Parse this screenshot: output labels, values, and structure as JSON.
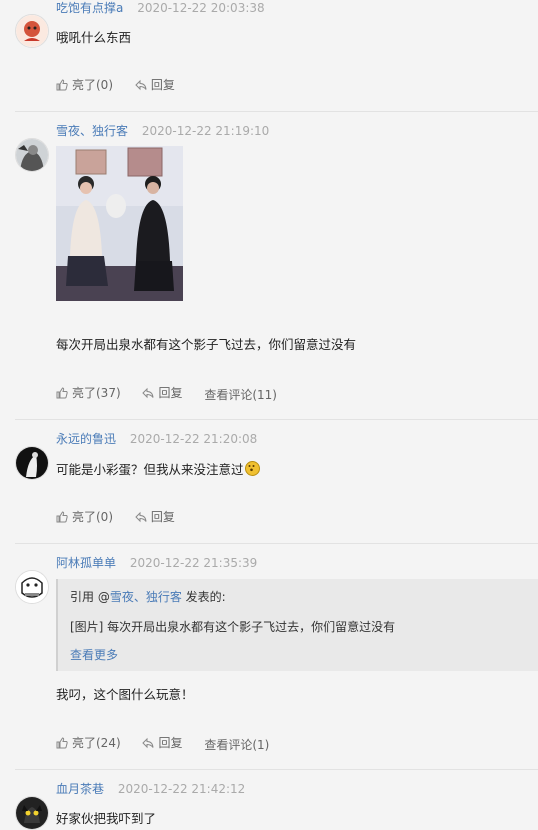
{
  "icons": {
    "like": "thumbs-up-icon",
    "reply": "reply-arrow-icon",
    "emoji": "surprised-emoji-icon"
  },
  "colors": {
    "username": "#4a7bb7",
    "timestamp": "#aaaaaa",
    "background": "#f4f4f4",
    "quote_bg": "#e9e9e9"
  },
  "comments": [
    {
      "username": "吃饱有点撑a",
      "time": "2020-12-22 20:03:38",
      "text": "哦吼什么东西",
      "like_label": "亮了(0)",
      "reply_label": "回复"
    },
    {
      "username": "雪夜、独行客",
      "time": "2020-12-22 21:19:10",
      "text": "每次开局出泉水都有这个影子飞过去，你们留意过没有",
      "like_label": "亮了(37)",
      "reply_label": "回复",
      "view_comments_label": "查看评论(11)"
    },
    {
      "username": "永远的鲁迅",
      "time": "2020-12-22 21:20:08",
      "text": "可能是小彩蛋？但我从来没注意过",
      "like_label": "亮了(0)",
      "reply_label": "回复"
    },
    {
      "username": "阿林孤单单",
      "time": "2020-12-22 21:35:39",
      "quote": {
        "prefix": "引用 @",
        "quoted_user": "雪夜、独行客",
        "suffix": " 发表的:",
        "body": "[图片] 每次开局出泉水都有这个影子飞过去，你们留意过没有",
        "more_label": "查看更多"
      },
      "text": "我叼，这个图什么玩意！",
      "like_label": "亮了(24)",
      "reply_label": "回复",
      "view_comments_label": "查看评论(1)"
    },
    {
      "username": "血月茶巷",
      "time": "2020-12-22 21:42:12",
      "text": "好家伙把我吓到了"
    }
  ]
}
